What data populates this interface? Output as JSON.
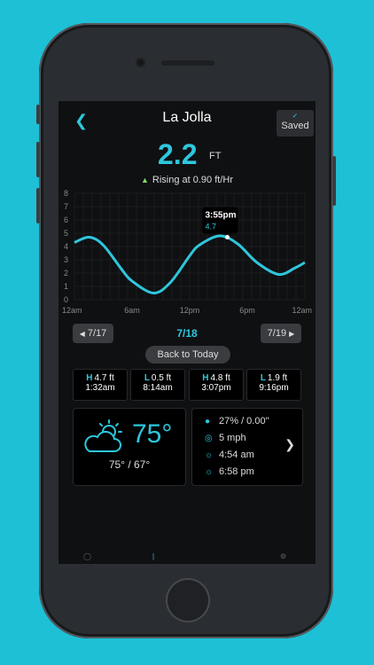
{
  "header": {
    "back_icon": "chevron-left-icon",
    "title": "La Jolla",
    "saved_label": "Saved"
  },
  "current": {
    "height": "2.2",
    "unit": "FT",
    "trend": "Rising at 0.90 ft/Hr"
  },
  "colors": {
    "background": "#1ec0d6",
    "accent": "#2ec7dd",
    "rising": "#7fdb6a",
    "screen": "#0f1012"
  },
  "chart_data": {
    "type": "line",
    "title": "",
    "xlabel": "",
    "ylabel": "",
    "x_ticks": [
      "12am",
      "6am",
      "12pm",
      "6pm",
      "12am"
    ],
    "y_ticks": [
      "0",
      "1",
      "2",
      "3",
      "4",
      "5",
      "6",
      "7",
      "8"
    ],
    "xlim": [
      0,
      24
    ],
    "ylim": [
      0,
      8
    ],
    "series": [
      {
        "x": [
          0,
          1.53,
          3,
          5,
          6,
          8.23,
          10,
          12,
          13,
          15.12,
          17,
          19,
          21.27,
          23,
          24
        ],
        "y": [
          4.3,
          4.7,
          4.1,
          2.2,
          1.4,
          0.5,
          1.3,
          3.3,
          4.1,
          4.8,
          4.2,
          2.8,
          1.9,
          2.4,
          2.8
        ]
      }
    ],
    "tooltip": {
      "time": "3:55pm",
      "value": "4.7",
      "x": 15.92,
      "y": 4.7
    }
  },
  "nav": {
    "prev_label": "7/17",
    "current_label": "7/18",
    "next_label": "7/19",
    "back_today": "Back to Today"
  },
  "tides": [
    {
      "type": "H",
      "height": "4.7 ft",
      "time": "1:32am"
    },
    {
      "type": "L",
      "height": "0.5 ft",
      "time": "8:14am"
    },
    {
      "type": "H",
      "height": "4.8 ft",
      "time": "3:07pm"
    },
    {
      "type": "L",
      "height": "1.9 ft",
      "time": "9:16pm"
    }
  ],
  "weather": {
    "icon": "partly-cloudy-icon",
    "temp": "75°",
    "hilo": "75° / 67°"
  },
  "details": {
    "precip": "27% / 0.00\"",
    "wind": "5 mph",
    "sunrise": "4:54 am",
    "sunset": "6:58 pm"
  }
}
